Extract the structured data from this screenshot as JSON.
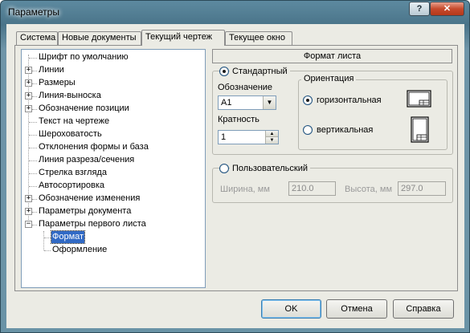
{
  "window": {
    "title": "Параметры",
    "help_glyph": "?",
    "close_glyph": "✕"
  },
  "tabs": [
    {
      "label": "Система",
      "active": false
    },
    {
      "label": "Новые документы",
      "active": false
    },
    {
      "label": "Текущий чертеж",
      "active": true
    },
    {
      "label": "Текущее окно",
      "active": false
    }
  ],
  "tree": {
    "items": [
      {
        "label": "Шрифт по умолчанию",
        "expander": ""
      },
      {
        "label": "Линии",
        "expander": "+"
      },
      {
        "label": "Размеры",
        "expander": "+"
      },
      {
        "label": "Линия-выноска",
        "expander": "+"
      },
      {
        "label": "Обозначение позиции",
        "expander": "+"
      },
      {
        "label": "Текст на чертеже",
        "expander": ""
      },
      {
        "label": "Шероховатость",
        "expander": ""
      },
      {
        "label": "Отклонения формы и база",
        "expander": ""
      },
      {
        "label": "Линия разреза/сечения",
        "expander": ""
      },
      {
        "label": "Стрелка взгляда",
        "expander": ""
      },
      {
        "label": "Автосортировка",
        "expander": ""
      },
      {
        "label": "Обозначение изменения",
        "expander": "+"
      },
      {
        "label": "Параметры документа",
        "expander": "+"
      },
      {
        "label": "Параметры первого листа",
        "expander": "−"
      }
    ],
    "children": [
      {
        "label": "Формат",
        "selected": true
      },
      {
        "label": "Оформление",
        "selected": false
      }
    ]
  },
  "panel": {
    "header": "Формат листа",
    "standard": {
      "legend": "Стандартный",
      "selected": true,
      "designation_label": "Обозначение",
      "designation_value": "A1",
      "multiplicity_label": "Кратность",
      "multiplicity_value": "1",
      "orientation": {
        "legend": "Ориентация",
        "landscape_label": "горизонтальная",
        "landscape_selected": true,
        "portrait_label": "вертикальная",
        "portrait_selected": false
      }
    },
    "custom": {
      "legend": "Пользовательский",
      "selected": false,
      "width_label": "Ширина, мм",
      "width_value": "210.0",
      "height_label": "Высота, мм",
      "height_value": "297.0"
    }
  },
  "buttons": {
    "ok": "OK",
    "cancel": "Отмена",
    "help": "Справка"
  }
}
